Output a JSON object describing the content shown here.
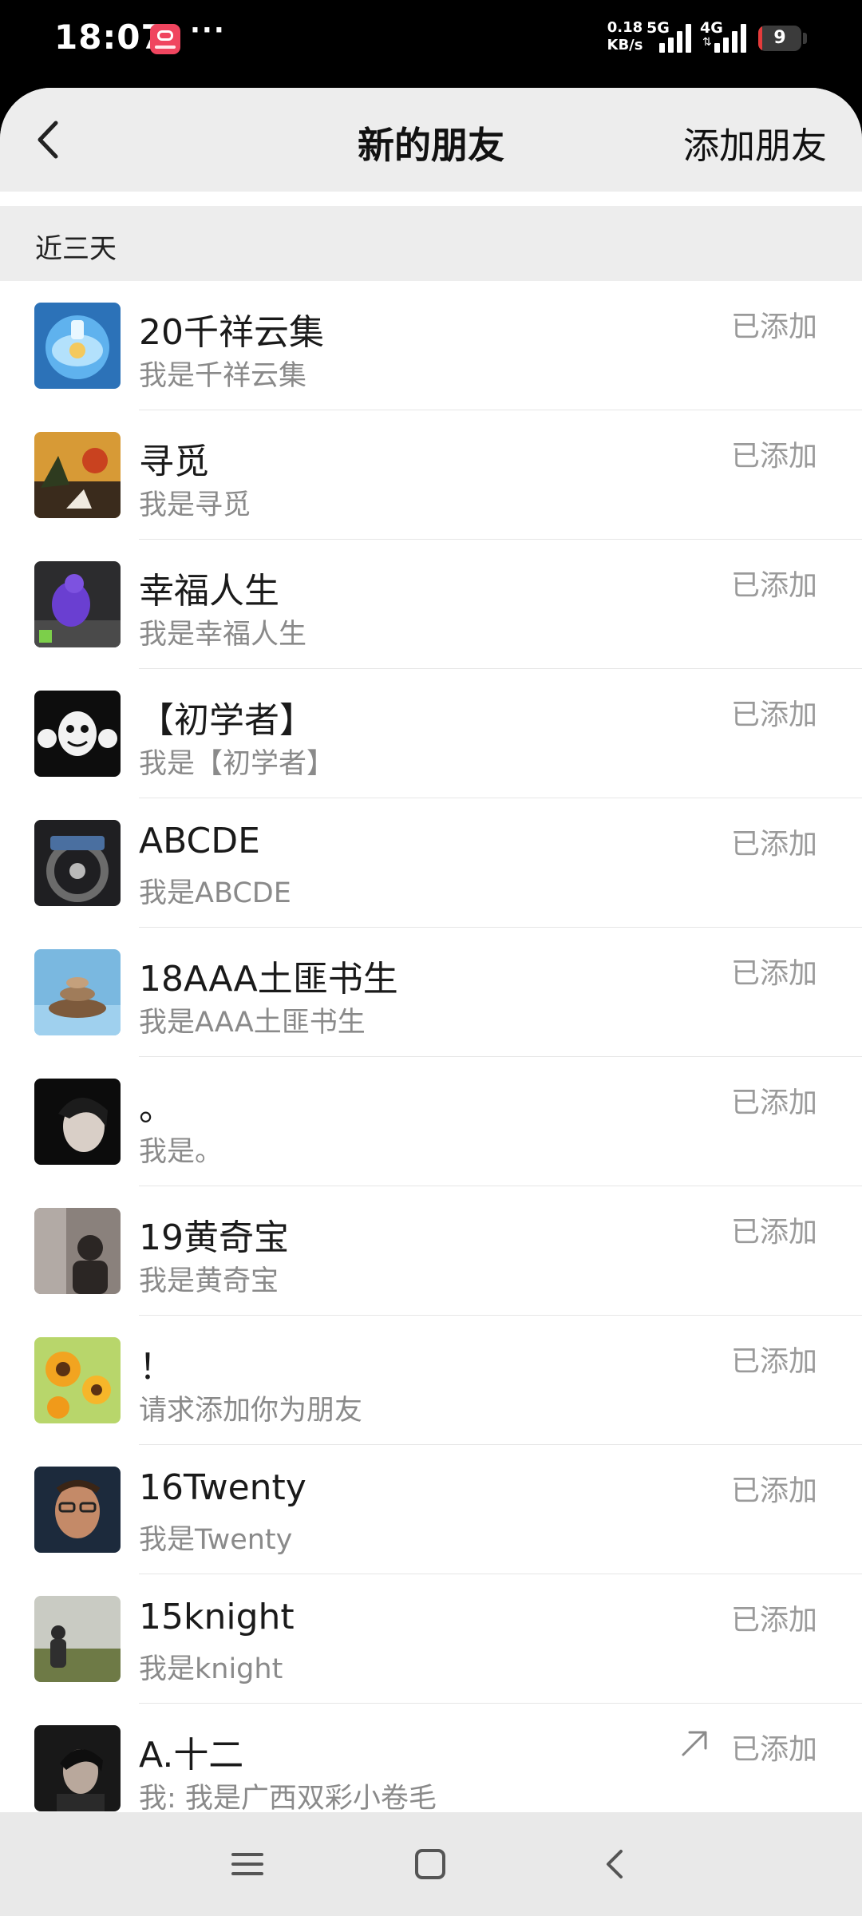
{
  "status_bar": {
    "time": "18:07",
    "app_badge_icon": "xiaohongshu-app-icon",
    "more_indicator": "···",
    "net_speed_value": "0.18",
    "net_speed_unit": "KB/s",
    "network_1": "5G",
    "network_2": "4G",
    "battery_level": "9",
    "battery_fraction": 0.09
  },
  "header": {
    "back_icon": "chevron-left-icon",
    "title": "新的朋友",
    "action_label": "添加朋友"
  },
  "section": {
    "title": "近三天"
  },
  "friends": [
    {
      "name": "20千祥云集",
      "message": "我是千祥云集",
      "status": "已添加",
      "avatar": "blue-glass-bottle"
    },
    {
      "name": "寻觅",
      "message": "我是寻觅",
      "status": "已添加",
      "avatar": "sunset-pine-painting"
    },
    {
      "name": "幸福人生",
      "message": "我是幸福人生",
      "status": "已添加",
      "avatar": "purple-hoodie-person"
    },
    {
      "name": "【初学者】",
      "message": "我是【初学者】",
      "status": "已添加",
      "avatar": "cartoon-face-hands"
    },
    {
      "name": "ABCDE",
      "message": "我是ABCDE",
      "status": "已添加",
      "avatar": "car-steering-wheel"
    },
    {
      "name": "18AAA土匪书生",
      "message": "我是AAA土匪书生",
      "status": "已添加",
      "avatar": "balanced-stones"
    },
    {
      "name": "。",
      "message": "我是。",
      "status": "已添加",
      "avatar": "dark-hair-portrait"
    },
    {
      "name": "19黄奇宝",
      "message": "我是黄奇宝",
      "status": "已添加",
      "avatar": "shadow-figure"
    },
    {
      "name": "！",
      "message": "请求添加你为朋友",
      "status": "已添加",
      "avatar": "sunflowers"
    },
    {
      "name": "16Twenty",
      "message": "我是Twenty",
      "status": "已添加",
      "avatar": "man-with-glasses"
    },
    {
      "name": "15knight",
      "message": "我是knight",
      "status": "已添加",
      "avatar": "person-on-grassland"
    },
    {
      "name": "A.十二",
      "message": "我: 我是广西双彩小卷毛",
      "status": "已添加",
      "avatar": "young-man-portrait",
      "action_icon": "share-arrow-icon"
    }
  ],
  "nav_bar": {
    "menu_icon": "menu-lines-icon",
    "home_icon": "home-square-icon",
    "back_icon": "back-triangle-icon"
  }
}
